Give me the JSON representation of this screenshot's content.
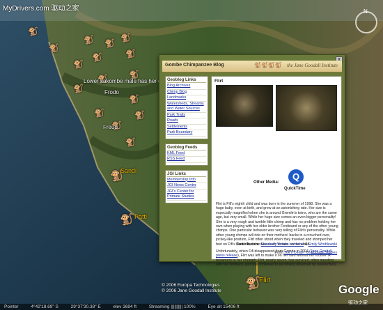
{
  "watermark": "MyDrivers.com 驱动之家",
  "compass": {
    "n_label": "N"
  },
  "map_labels": {
    "lower_kakombe": "Lower kakombe male has her day",
    "frodo": "Frodo",
    "freud": "Freud",
    "sandi": "Sandi",
    "patti": "Patti",
    "flirt": "Flirt"
  },
  "popup": {
    "header_title": "Gombe Chimpanzee Blog",
    "brand": "the Jane Goodall Institute",
    "close_icon": "x",
    "geoblog_links": {
      "heading": "Geoblog Links",
      "items": [
        "Blog Archives",
        "Chimp Blog",
        "Landmarks",
        "Watersheds, Streams and Water Sources",
        "Park Trails",
        "Roads",
        "Settlements",
        "Park Boundary"
      ]
    },
    "geoblog_feeds": {
      "heading": "Geoblog Feeds",
      "items": [
        "KML Feed",
        "RSS Feed"
      ]
    },
    "jgi_links": {
      "heading": "JGI Links",
      "items": [
        "Membership Info",
        "JGI News Center",
        "JGI's Center for Primate Studies"
      ]
    },
    "post": {
      "title": "Flirt",
      "other_media_label": "Other Media:",
      "quicktime_label": "QuickTime",
      "para1": "Flirt is Fifi's eighth child and was born in the summer of 1998. She was a huge baby, even at birth, and grew at an astonishing rate. Her size is especially magnified when she is around Gremlin's twins, who are the same age, but very small. While her huge size comes an even bigger personality! She is a very rough and tumble little chimp and has no problem holding her own when playing with her older brother Ferdinand or any of the other young chimps. One particular behavior was very telling of Flirt's personality. While other young chimps will ride on their mothers' backs in a crouched over, jockey-like position, Flirt often stood when they traveled and stomped her feet on Fifi's back - like she was ready to take on the world.",
      "para2_a": "Unfortunately, when Fifi disappeared from Gombe in 2004 (",
      "para2_link": "Jane Goodall press release",
      "para2_b": "), Flirt was left to make it on her own without her mother. A testament to her strength, Flirt, nearly seven, has survived, often traveling with her brothers, and she continues to be closely observed by researchers.",
      "contributors_label": "Contributors:",
      "contributor1": "Elizabeth Vinson Lonsdorf",
      "contributors_sep": "&",
      "contributor2": "Emily Wroblewski",
      "from_label": "From",
      "from_link": "JGI's Center for Primate Studies"
    }
  },
  "copyright": {
    "line1": "© 2006 Europa Technologies",
    "line2": "© 2006 Jane Goodall Institute"
  },
  "google_logo": "Google",
  "watermark_bottom": "驱动之家",
  "status_bar": {
    "pointer": "Pointer",
    "lat": "4°42'18.69\" S",
    "lon": "29°37'30.38\" E",
    "elev": "elev 3694 ft",
    "streaming": "Streaming |||||||||| 100%",
    "eye_alt": "Eye alt 15406 ft"
  },
  "colors": {
    "popup_bg": "#6a7a3a",
    "accent": "#f2b800",
    "link": "#1a2e9c"
  }
}
